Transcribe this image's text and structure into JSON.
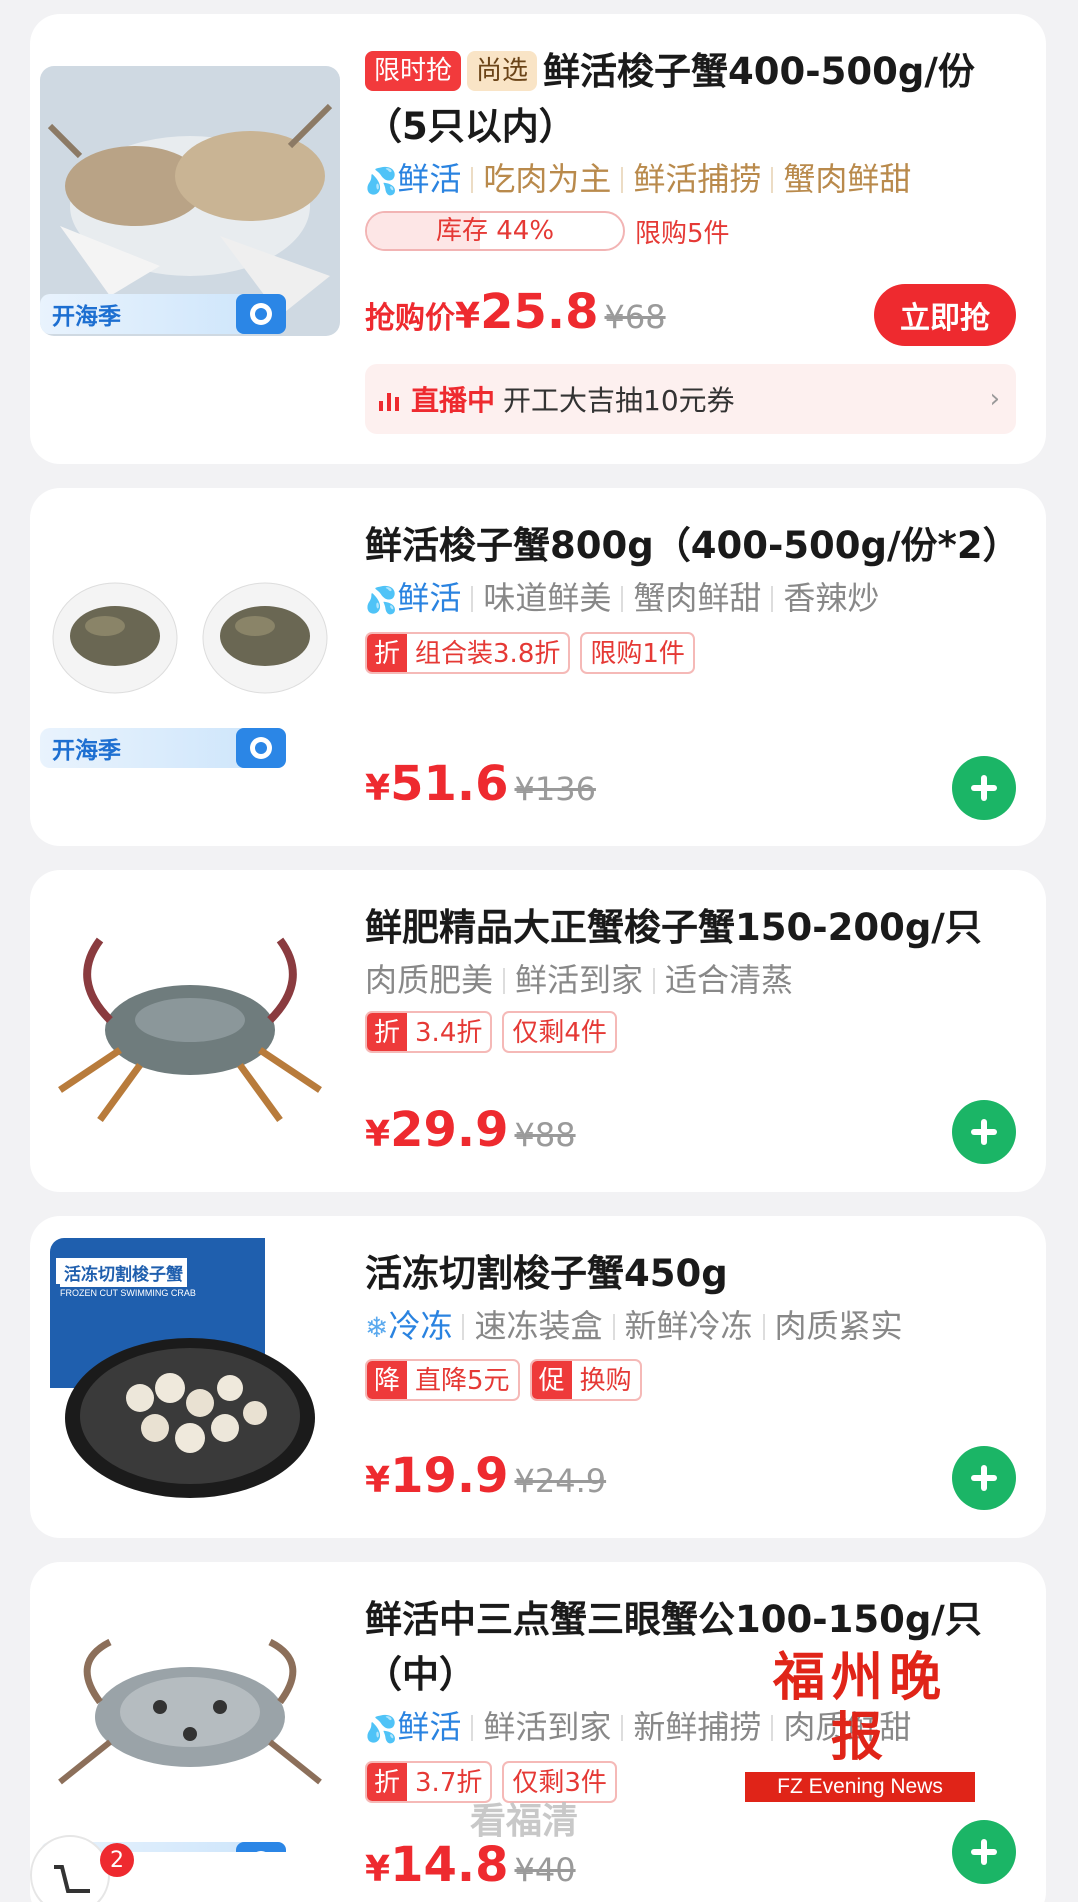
{
  "season_tag": "开海季",
  "products": [
    {
      "badges": [
        "限时抢",
        "尚选"
      ],
      "title": "鲜活梭子蟹400-500g/份（5只以内）",
      "fresh": "鲜活",
      "tags": [
        "吃肉为主",
        "鲜活捕捞",
        "蟹肉鲜甜"
      ],
      "stock_label": "库存 44%",
      "stock_percent": 44,
      "limit_text": "限购5件",
      "price_prefix": "抢购价",
      "currency": "¥",
      "price": "25.8",
      "original": "¥68",
      "buy_button": "立即抢",
      "live_label": "直播中",
      "live_text": "开工大吉抽10元券"
    },
    {
      "title": "鲜活梭子蟹800g（400-500g/份*2）",
      "fresh": "鲜活",
      "tags": [
        "味道鲜美",
        "蟹肉鲜甜",
        "香辣炒"
      ],
      "coupons": [
        {
          "k": "折",
          "v": "组合装3.8折"
        }
      ],
      "extra_tag": "限购1件",
      "currency": "¥",
      "price": "51.6",
      "original": "¥136"
    },
    {
      "title": "鲜肥精品大正蟹梭子蟹150-200g/只",
      "tags": [
        "肉质肥美",
        "鲜活到家",
        "适合清蒸"
      ],
      "coupons": [
        {
          "k": "折",
          "v": "3.4折"
        }
      ],
      "extra_tag": "仅剩4件",
      "currency": "¥",
      "price": "29.9",
      "original": "¥88"
    },
    {
      "title": "活冻切割梭子蟹450g",
      "frozen": "冷冻",
      "tags": [
        "速冻装盒",
        "新鲜冷冻",
        "肉质紧实"
      ],
      "coupons": [
        {
          "k": "降",
          "v": "直降5元"
        },
        {
          "k": "促",
          "v": "换购"
        }
      ],
      "box_label": "活冻切割梭子蟹",
      "box_sub": "FROZEN CUT SWIMMING CRAB",
      "currency": "¥",
      "price": "19.9",
      "original": "¥24.9"
    },
    {
      "title": "鲜活中三点蟹三眼蟹公100-150g/只（中）",
      "fresh": "鲜活",
      "tags": [
        "鲜活到家",
        "新鲜捕捞",
        "肉质鲜甜"
      ],
      "coupons": [
        {
          "k": "折",
          "v": "3.7折"
        }
      ],
      "extra_tag": "仅剩3件",
      "currency": "¥",
      "price": "14.8",
      "original": "¥40"
    }
  ],
  "cart_count": "2",
  "watermark_cn": "福州晚报",
  "watermark_en": "FZ Evening News",
  "watermark2": "看福清",
  "colors": {
    "price_red": "#ee2a2f",
    "add_green": "#1bb566",
    "fresh_blue": "#2a83e0"
  }
}
